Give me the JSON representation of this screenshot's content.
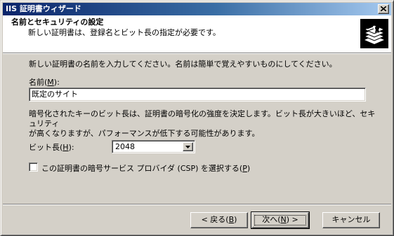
{
  "window": {
    "title": "IIS 証明書ウィザード",
    "close_glyph": "×"
  },
  "header": {
    "title": "名前とセキュリティの設定",
    "subtitle": "新しい証明書は、登録名とビット長の指定が必要です。",
    "icon": "certificate-stack-icon"
  },
  "body": {
    "intro": "新しい証明書の名前を入力してください。名前は簡単で覚えやすいものにしてください。",
    "name_label_prefix": "名前(",
    "name_label_key": "M",
    "name_label_suffix": "):",
    "name_value": "既定のサイト",
    "description_line1": "暗号化されたキーのビット長は、証明書の暗号化の強度を決定します。ビット長が大きいほど、セキュリティ",
    "description_line2": "が高くなりますが、パフォーマンスが低下する可能性があります。",
    "bit_label_prefix": "ビット長(",
    "bit_label_key": "H",
    "bit_label_suffix": "):",
    "bit_length_selected": "2048",
    "csp_checked": false,
    "csp_label_prefix": "この証明書の暗号サービス プロバイダ (CSP) を選択する(",
    "csp_label_key": "P",
    "csp_label_suffix": ")"
  },
  "buttons": {
    "back_prefix": "< 戻る(",
    "back_key": "B",
    "back_suffix": ")",
    "next_prefix": "次へ(",
    "next_key": "N",
    "next_suffix": ") >",
    "cancel": "キャンセル"
  },
  "colors": {
    "face": "#d4d0c8",
    "title_start": "#0a246a",
    "title_end": "#a6caf0"
  }
}
